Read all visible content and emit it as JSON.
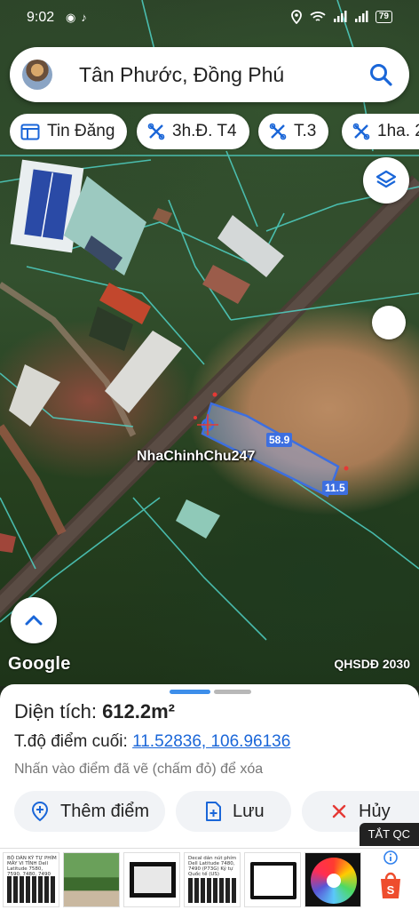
{
  "status_bar": {
    "time": "9:02",
    "battery": "79"
  },
  "search": {
    "query": "Tân Phước, Đồng Phú"
  },
  "chips": [
    {
      "label": "Tin Đăng",
      "icon": "calendar-icon"
    },
    {
      "label": "3h.Đ. T4",
      "icon": "tools-icon"
    },
    {
      "label": "T.3",
      "icon": "tools-icon"
    },
    {
      "label": "1ha. 2",
      "icon": "tools-icon"
    }
  ],
  "map": {
    "watermark": "NhaChinhChu247",
    "length_label": "58.9",
    "width_label": "11.5",
    "provider": "Google",
    "credit": "QHSDĐ 2030"
  },
  "sheet": {
    "area_label": "Diện tích:",
    "area_value": "612.2m²",
    "coord_label": "T.độ điểm cuối:",
    "coord_value": "11.52836, 106.96136",
    "hint": "Nhấn vào điểm đã vẽ (chấm đỏ) để xóa",
    "add_point": "Thêm điểm",
    "save": "Lưu",
    "cancel": "Hủy"
  },
  "ads": {
    "close_label": "TẮT QC",
    "captions": [
      "BỘ DÁN KÝ TỰ PHÍM MÁY VI TÍNH Dell Latitude 7580, 7590, 7480, 7490 (P35S)",
      "",
      "",
      "Decal dán nút phím Dell Latitude 7480, 7490 (P73G) Ký tự Quốc tế (US)",
      "",
      "",
      ""
    ]
  },
  "colors": {
    "accent_blue": "#1a66d8",
    "parcel_outline": "#3d6fe0",
    "marker_red": "#e53935"
  }
}
